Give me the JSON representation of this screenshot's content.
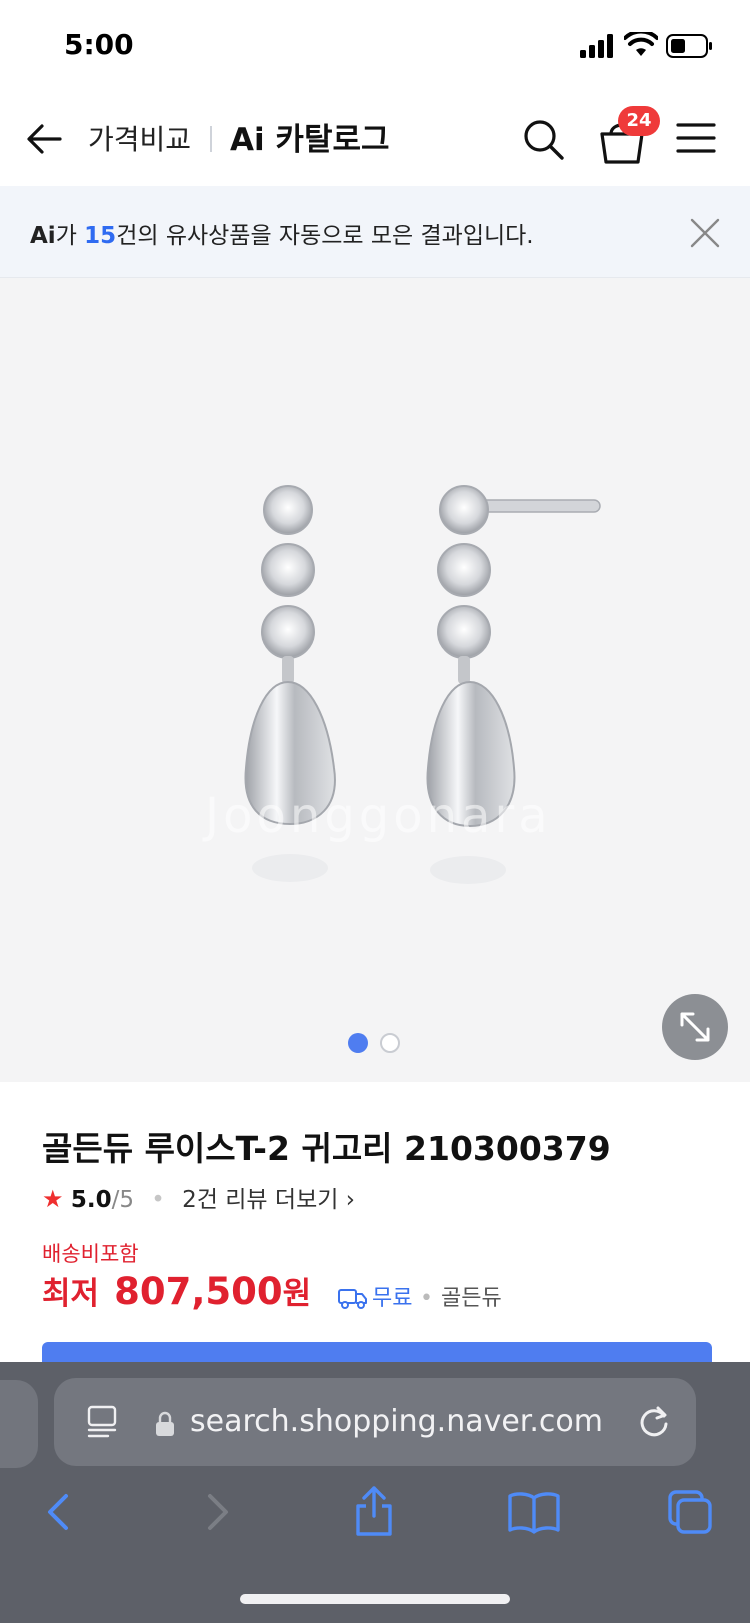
{
  "status_bar": {
    "time": "5:00"
  },
  "header": {
    "breadcrumb": "가격비교",
    "ai_mark": "Ai",
    "catalog_label": "카탈로그",
    "cart_count": "24"
  },
  "ai_banner": {
    "ai_mark": "Ai",
    "prefix": "가 ",
    "count": "15",
    "suffix": "건의 유사상품을 자동으로 모은 결과입니다."
  },
  "gallery": {
    "watermark": "Joonggonara",
    "page_count": 2,
    "active_page": 1
  },
  "product": {
    "title": "골든듀 루이스T-2 귀고리 210300379",
    "rating": "5.0",
    "rating_max": "/5",
    "review_link": "2건 리뷰 더보기",
    "shipping_included": "배송비포함",
    "price_label": "최저",
    "price": "807,500",
    "price_unit": "원",
    "shipping_free": "무료",
    "seller": "골든듀"
  },
  "browser": {
    "url": "search.shopping.naver.com"
  },
  "colors": {
    "accent_blue": "#4f7df0",
    "price_red": "#e0212f",
    "badge_red": "#ef3a3a",
    "banner_bg": "#f2f5fa",
    "toolbar_bg": "#5d6068"
  }
}
